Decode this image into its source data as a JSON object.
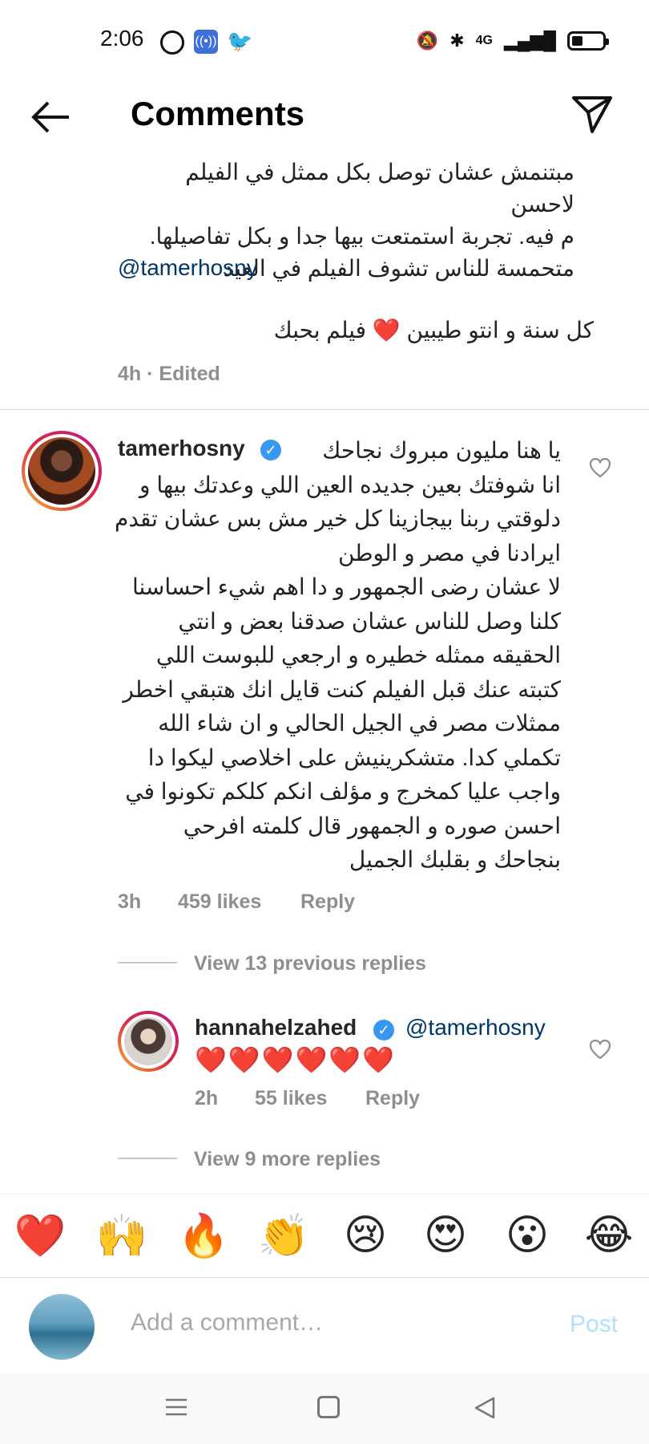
{
  "status_bar": {
    "time": "2:06",
    "right_text": "4G"
  },
  "header": {
    "title": "Comments"
  },
  "caption": {
    "lines": [
      "مبتنمش عشان توصل بكل ممثل في الفيلم لاحسن",
      "م فيه. تجربة استمتعت بيها جدا و بكل تفاصيلها.",
      "متحمسة للناس تشوف الفيلم في العيد"
    ],
    "mention": "@tamerhosny",
    "line2": "كل سنة و انتو طيبين ❤️ فيلم بحبك",
    "time_meta": "4h · Edited"
  },
  "comment1": {
    "username": "tamerhosny",
    "text": "يا هنا مليون مبروك نجاحك\nانا شوفتك بعين جديده  العين اللي وعدتك بيها و دلوقتي ربنا بيجازينا كل خير مش بس عشان تقدم ايرادنا في مصر و الوطن\nلا عشان رضى الجمهور و دا اهم شيء احساسنا كلنا وصل للناس عشان صدقنا بعض و انتي الحقيقه ممثله خطيره و ارجعي للبوست اللي كتبته عنك قبل الفيلم كنت قايل انك هتبقي اخطر ممثلات مصر في الجيل الحالي و ان شاء الله تكملي كدا. متشكرينيش على اخلاصي ليكوا دا واجب عليا كمخرج و مؤلف انكم كلكم تكونوا في احسن صوره و الجمهور قال كلمته افرحي بنجاحك و بقلبك الجميل",
    "time": "3h",
    "likes": "459 likes",
    "reply": "Reply"
  },
  "view_previous": "View 13 previous replies",
  "reply1": {
    "username": "hannahelzahed",
    "mention": "@tamerhosny",
    "hearts": "❤️❤️❤️❤️❤️❤️",
    "time": "2h",
    "likes": "55 likes",
    "reply": "Reply"
  },
  "view_more": "View 9 more replies",
  "emoji_bar": [
    "❤️",
    "🙌",
    "🔥",
    "👏",
    "😢",
    "😍",
    "😮",
    "😂"
  ],
  "composer": {
    "placeholder": "Add a comment…",
    "post_label": "Post"
  },
  "colors": {
    "link": "#00376b",
    "meta": "#8e8e8e",
    "post_disabled": "#b2dffc",
    "verified": "#3897f0"
  }
}
